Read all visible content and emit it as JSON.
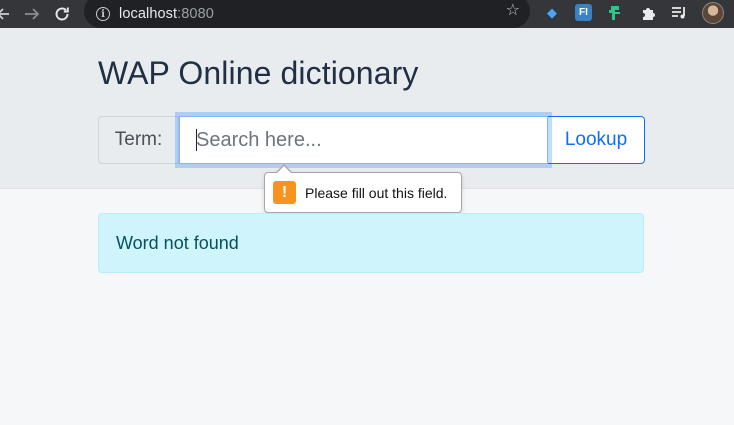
{
  "browser": {
    "url_host": "localhost",
    "url_port": ":8080",
    "extensions": [
      "gem-extension-icon",
      "fi-extension-icon",
      "dino-extension-icon",
      "puzzle-icon",
      "queue-icon"
    ],
    "ext_fi_label": "FI"
  },
  "page": {
    "title": "WAP Online dictionary",
    "term_label": "Term:",
    "search_placeholder": "Search here...",
    "search_value": "",
    "lookup_label": "Lookup",
    "validation_message": "Please fill out this field.",
    "alert_message": "Word not found"
  },
  "colors": {
    "accent": "#0d6efd",
    "alert_bg": "#cff4fc",
    "alert_text": "#055160",
    "warning": "#f7931e"
  }
}
